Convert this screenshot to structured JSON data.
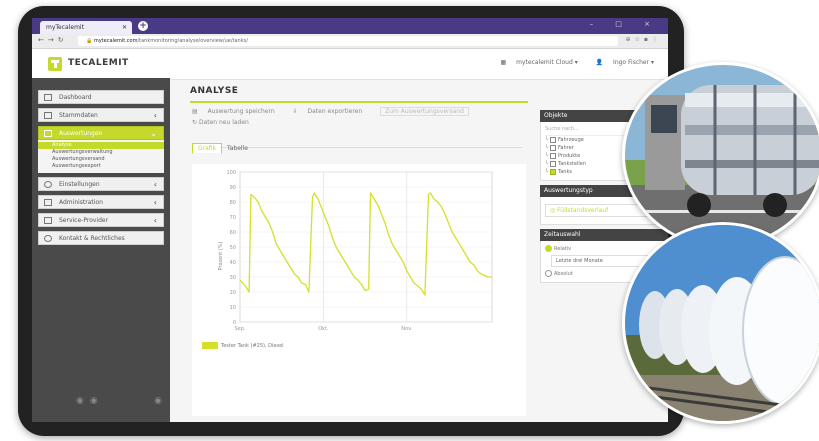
{
  "browser": {
    "tab_title": "myTecalemit",
    "url_host": "mytecalemit.com",
    "url_path": "/tankmonitoring/analyse/overview/ue/tanks/",
    "window_controls": "– □ ×"
  },
  "header": {
    "brand": "TECALEMIT",
    "cloud_menu": "mytecalemit Cloud ▾",
    "user_menu": "Ingo Fischer ▾"
  },
  "sidebar": {
    "items": [
      {
        "label": "Dashboard"
      },
      {
        "label": "Stammdaten",
        "chevron": "‹"
      },
      {
        "label": "Auswertungen",
        "chevron": "⌄"
      },
      {
        "label": "Einstellungen",
        "chevron": "‹"
      },
      {
        "label": "Administration",
        "chevron": "‹"
      },
      {
        "label": "Service-Provider",
        "chevron": "‹"
      },
      {
        "label": "Kontakt & Rechtliches"
      }
    ],
    "subitems": [
      "Analyse",
      "Auswertungsverwaltung",
      "Auswertungsversand",
      "Auswertungsexport"
    ]
  },
  "main": {
    "title": "ANALYSE",
    "actions": {
      "save": "Auswertung speichern",
      "export": "Daten exportieren",
      "pill": "Zum Auswertungsversand"
    },
    "reload": "Daten neu laden",
    "tabs": [
      "Grafik",
      "Tabelle"
    ]
  },
  "right_panel": {
    "objects_header": "Objekte",
    "search_placeholder": "Suche nach...",
    "tree": [
      "Fahrzeuge",
      "Fahrer",
      "Produkte",
      "Tankstellen",
      "Tanks"
    ],
    "type_header": "Auswertungstyp",
    "type_value": "Füllstandsverlauf",
    "time_header": "Zeitauswahl",
    "relative_label": "Relativ",
    "relative_value": "Letzte drei Monate",
    "absolute_label": "Absolut"
  },
  "colors": {
    "accent": "#c5d82c",
    "series": "#d4e02a",
    "sidebar_bg": "#4a4a4a"
  },
  "chart_data": {
    "type": "line",
    "ylabel": "Prozent (%)",
    "ylim": [
      0,
      100
    ],
    "yticks": [
      0,
      10,
      20,
      30,
      40,
      50,
      60,
      70,
      80,
      90,
      100
    ],
    "x_ticks": [
      "Sep.",
      "Okt.",
      "Nov."
    ],
    "series": [
      {
        "name": "Tester Tank (#25), Diesel",
        "x": [
          0,
          3,
          5,
          6,
          8,
          10,
          12,
          14,
          16,
          18,
          20,
          22,
          24,
          26,
          28,
          30,
          32,
          34,
          36,
          38,
          40,
          41,
          43,
          45,
          47,
          49,
          51,
          53,
          55,
          57,
          59,
          61,
          63,
          65,
          67,
          69,
          71,
          72,
          74,
          76,
          78,
          80,
          82,
          84,
          86,
          88,
          90,
          92,
          94,
          96,
          98,
          100,
          102,
          104,
          105,
          107,
          109,
          111,
          113,
          115,
          117,
          119,
          121,
          123,
          125,
          127,
          129,
          131,
          133,
          135,
          137,
          139
        ],
        "y": [
          28,
          24,
          20,
          85,
          83,
          80,
          74,
          70,
          66,
          60,
          52,
          48,
          44,
          40,
          36,
          32,
          30,
          26,
          25,
          20,
          83,
          86,
          82,
          76,
          70,
          64,
          56,
          50,
          46,
          42,
          38,
          34,
          30,
          28,
          25,
          21,
          22,
          86,
          82,
          78,
          72,
          66,
          58,
          52,
          48,
          44,
          40,
          34,
          30,
          26,
          24,
          22,
          18,
          85,
          86,
          82,
          80,
          77,
          72,
          66,
          60,
          56,
          52,
          48,
          44,
          40,
          38,
          34,
          32,
          31,
          30,
          30
        ]
      }
    ],
    "legend_position": "bottom-left",
    "grid": true
  }
}
